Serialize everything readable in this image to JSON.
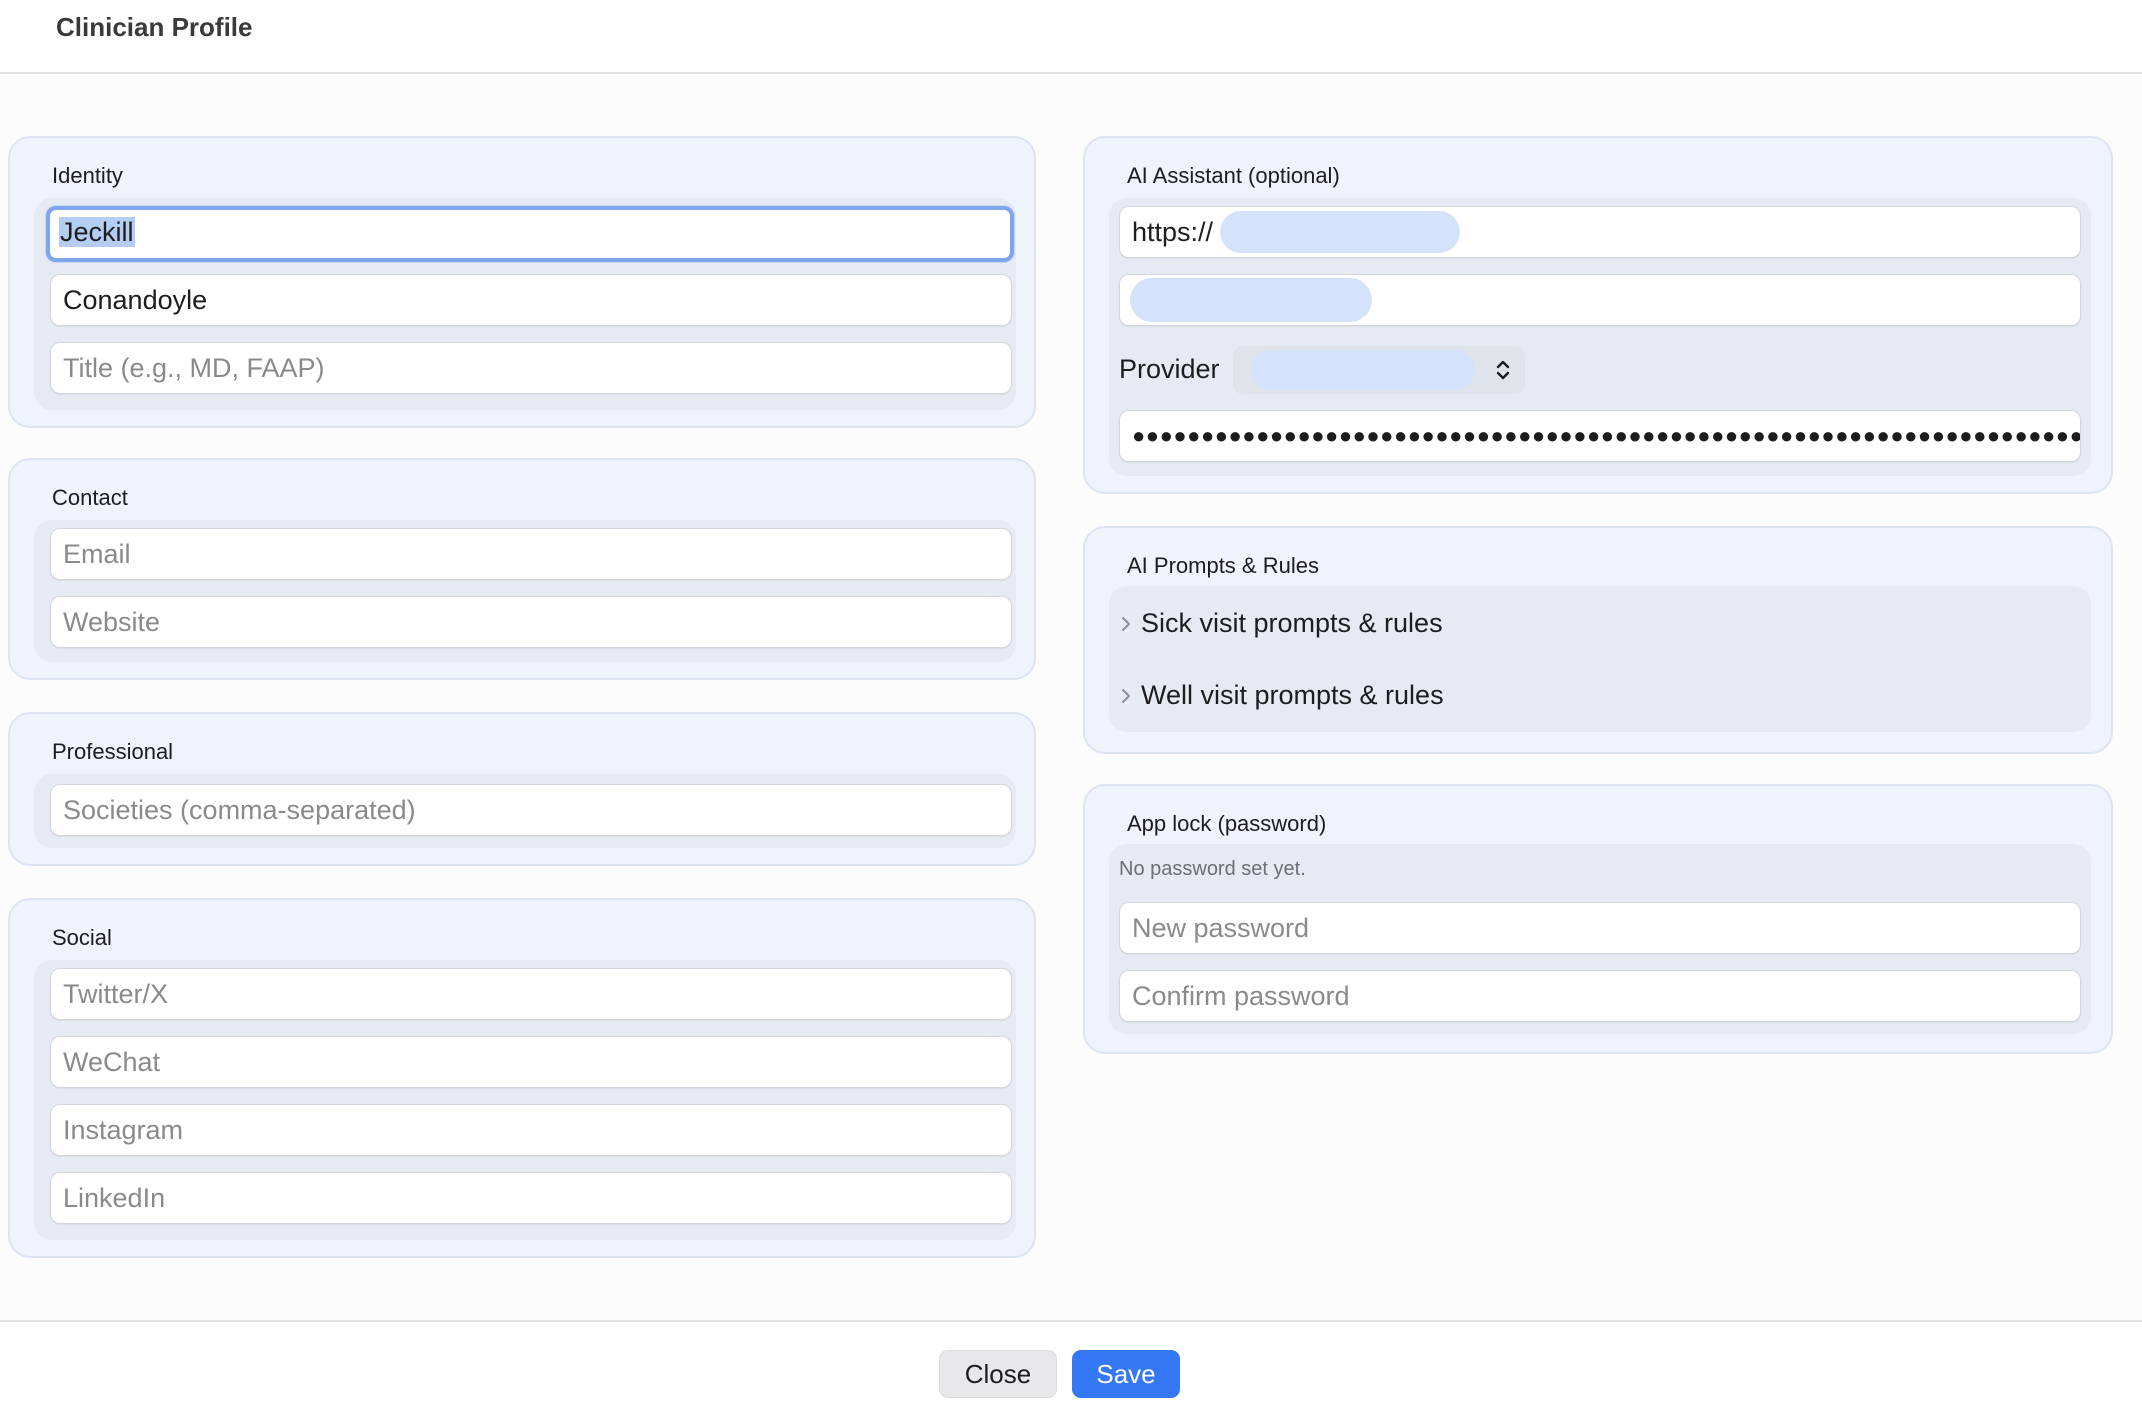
{
  "window": {
    "title": "Clinician Profile"
  },
  "identity": {
    "title": "Identity",
    "first_name": "Jeckill",
    "last_name": "Conandoyle",
    "title_placeholder": "Title (e.g., MD, FAAP)"
  },
  "contact": {
    "title": "Contact",
    "email_placeholder": "Email",
    "website_placeholder": "Website"
  },
  "professional": {
    "title": "Professional",
    "societies_placeholder": "Societies (comma-separated)"
  },
  "social": {
    "title": "Social",
    "twitter_placeholder": "Twitter/X",
    "wechat_placeholder": "WeChat",
    "instagram_placeholder": "Instagram",
    "linkedin_placeholder": "LinkedIn"
  },
  "ai_assistant": {
    "title": "AI Assistant (optional)",
    "endpoint_value": "https://",
    "provider_label": "Provider",
    "api_key_masked": "●●●●●●●●●●●●●●●●●●●●●●●●●●●●●●●●●●●●●●●●●●●●●●●●●●●●●●●●●●●●●●●●●●●●●●●●●●●●●●"
  },
  "ai_prompts": {
    "title": "AI Prompts & Rules",
    "items": [
      {
        "label": "Sick visit prompts & rules"
      },
      {
        "label": "Well visit prompts & rules"
      }
    ]
  },
  "app_lock": {
    "title": "App lock (password)",
    "status": "No password set yet.",
    "new_password_placeholder": "New password",
    "confirm_password_placeholder": "Confirm password"
  },
  "footer": {
    "close_label": "Close",
    "save_label": "Save"
  },
  "colors": {
    "accent": "#3478f6",
    "section_bg": "#eef3fc",
    "focus_ring": "#7ea6ea"
  }
}
